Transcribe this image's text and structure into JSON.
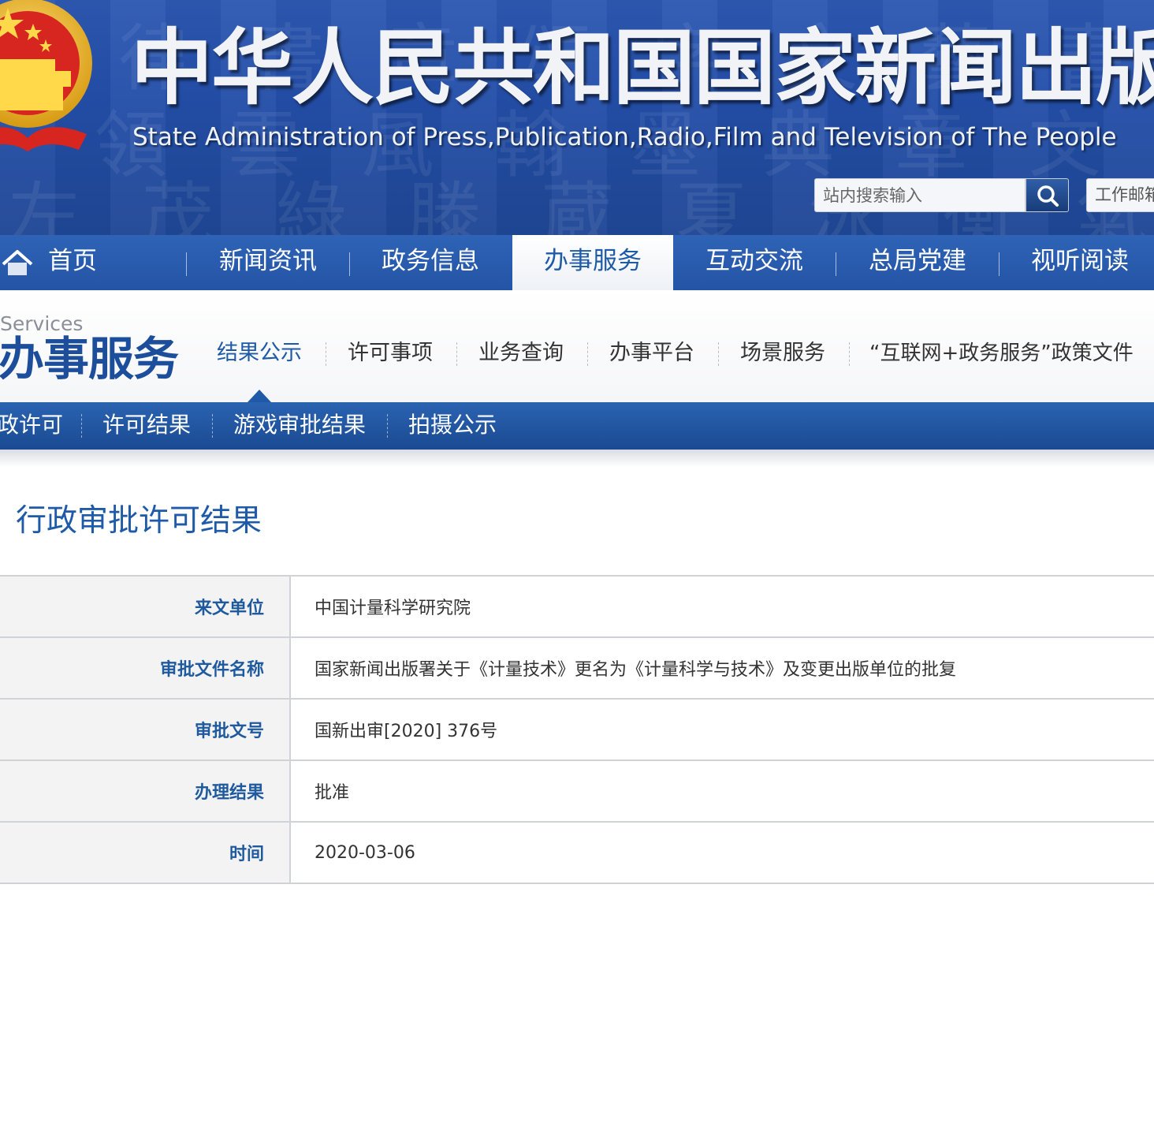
{
  "header": {
    "site_title": "中华人民共和国国家新闻出版广",
    "site_subtitle": "State Administration of Press,Publication,Radio,Film and Television of The People",
    "search": {
      "placeholder": "站内搜索输入"
    },
    "mail_label": "工作邮箱"
  },
  "main_nav": {
    "active": "办事服务",
    "items": [
      "首页",
      "新闻资讯",
      "政务信息",
      "办事服务",
      "互动交流",
      "总局党建",
      "视听阅读"
    ]
  },
  "section": {
    "label_en": "Services",
    "label_cn": "办事服务",
    "active": "结果公示",
    "subnav": [
      "结果公示",
      "许可事项",
      "业务查询",
      "办事平台",
      "场景服务",
      "“互联网+政务服务”政策文件"
    ]
  },
  "tabs": [
    "政许可",
    "许可结果",
    "游戏审批结果",
    "拍摄公示"
  ],
  "content": {
    "heading": "行政审批许可结果",
    "rows": [
      {
        "label": "来文单位",
        "value": "中国计量科学研究院"
      },
      {
        "label": "审批文件名称",
        "value": "国家新闻出版署关于《计量技术》更名为《计量科学与技术》及变更出版单位的批复"
      },
      {
        "label": "审批文号",
        "value": "国新出审[2020] 376号"
      },
      {
        "label": "办理结果",
        "value": "批准"
      },
      {
        "label": "时间",
        "value": "2020-03-06"
      }
    ]
  },
  "colors": {
    "banner_blue": "#234ea8",
    "nav_blue": "#2a5db0",
    "accent_blue": "#1e5aa8",
    "table_border": "#cfd2d7"
  }
}
